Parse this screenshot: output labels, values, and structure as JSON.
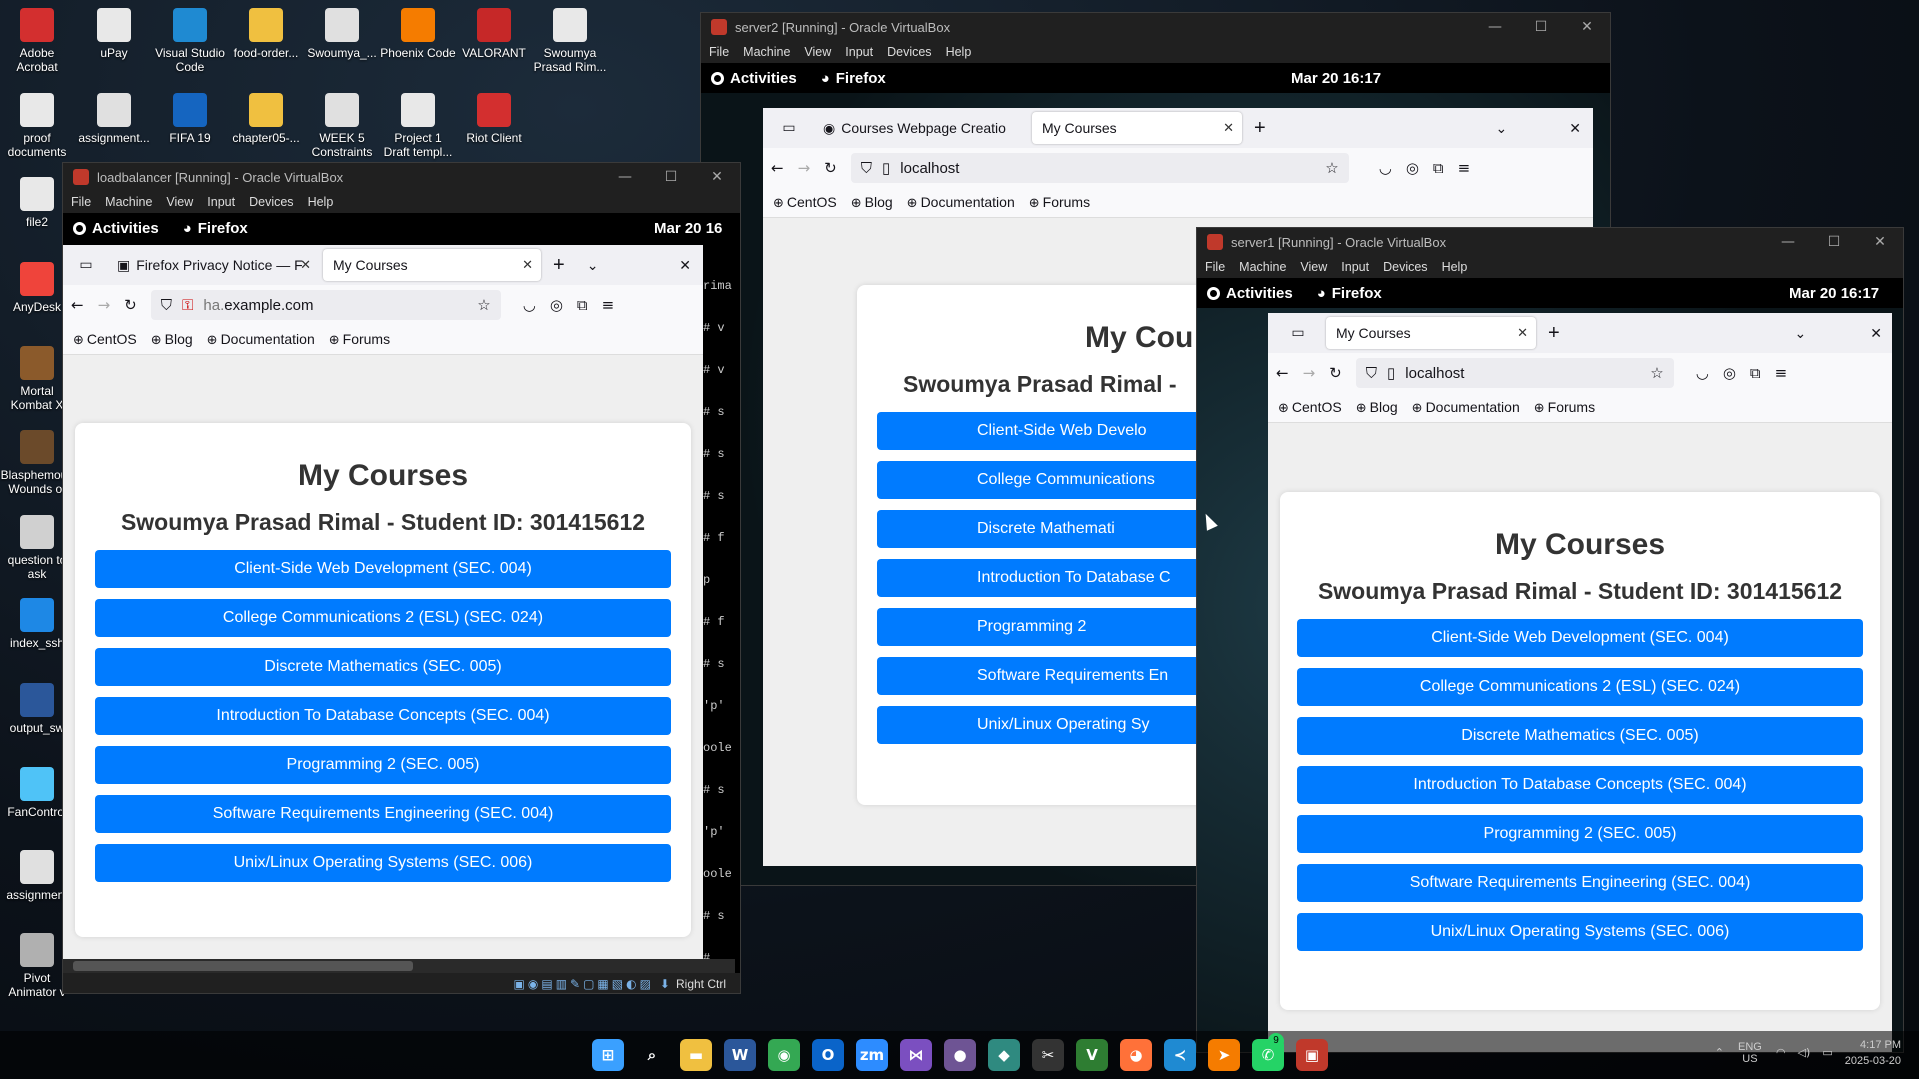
{
  "desktop": {
    "icons_col1": [
      {
        "label": "Adobe Acrobat",
        "icon": "acrobat-icon",
        "color": "#d32f2f"
      },
      {
        "label": "proof documents",
        "icon": "chrome-doc-icon",
        "color": "#e8e8e8"
      },
      {
        "label": "file2",
        "icon": "chrome-doc-icon",
        "color": "#e8e8e8"
      },
      {
        "label": "AnyDesk",
        "icon": "anydesk-icon",
        "color": "#ef443b"
      },
      {
        "label": "Mortal Kombat X",
        "icon": "game-icon",
        "color": "#8b5a2b"
      },
      {
        "label": "Blasphemous Wounds of",
        "icon": "game-icon",
        "color": "#6b4a2a"
      },
      {
        "label": "question to ask",
        "icon": "doc-icon",
        "color": "#d0d0d0"
      },
      {
        "label": "index_ssh",
        "icon": "edge-icon",
        "color": "#1e88e5"
      },
      {
        "label": "output_sw",
        "icon": "word-icon",
        "color": "#2b579a"
      },
      {
        "label": "FanControl",
        "icon": "fan-icon",
        "color": "#4fc3f7"
      },
      {
        "label": "assignment",
        "icon": "doc-icon",
        "color": "#e0e0e0"
      },
      {
        "label": "Pivot Animator v",
        "icon": "pivot-icon",
        "color": "#b0b0b0"
      }
    ],
    "icons_row1": [
      {
        "label": "uPay",
        "icon": "chrome-doc-icon",
        "color": "#e8e8e8"
      },
      {
        "label": "Visual Studio Code",
        "icon": "vscode-icon",
        "color": "#1f8ad2"
      },
      {
        "label": "food-order...",
        "icon": "folder-icon",
        "color": "#f0c040"
      },
      {
        "label": "Swoumya_...",
        "icon": "pdf-icon",
        "color": "#e0e0e0"
      },
      {
        "label": "Phoenix Code",
        "icon": "phoenix-icon",
        "color": "#f57c00"
      },
      {
        "label": "VALORANT",
        "icon": "valorant-icon",
        "color": "#c62828"
      },
      {
        "label": "Swoumya Prasad Rim...",
        "icon": "chrome-doc-icon",
        "color": "#e8e8e8"
      }
    ],
    "icons_row2": [
      {
        "label": "assignment...",
        "icon": "doc-icon",
        "color": "#e0e0e0"
      },
      {
        "label": "FIFA 19",
        "icon": "fifa-icon",
        "color": "#1565c0"
      },
      {
        "label": "chapter05-...",
        "icon": "folder-icon",
        "color": "#f0c040"
      },
      {
        "label": "WEEK 5 Constraints",
        "icon": "pdf-icon",
        "color": "#e0e0e0"
      },
      {
        "label": "Project 1 Draft templ...",
        "icon": "chrome-doc-icon",
        "color": "#e8e8e8"
      },
      {
        "label": "Riot Client",
        "icon": "riot-icon",
        "color": "#d32f2f"
      }
    ]
  },
  "course_page": {
    "title": "My Courses",
    "student": "Swoumya Prasad Rimal - Student ID: 301415612",
    "courses": [
      "Client-Side Web Development (SEC. 004)",
      "College Communications 2 (ESL) (SEC. 024)",
      "Discrete Mathematics (SEC. 005)",
      "Introduction To Database Concepts (SEC. 004)",
      "Programming 2 (SEC. 005)",
      "Software Requirements Engineering (SEC. 004)",
      "Unix/Linux Operating Systems (SEC. 006)"
    ],
    "button_color": "#007bff"
  },
  "vbox_menu": [
    "File",
    "Machine",
    "View",
    "Input",
    "Devices",
    "Help"
  ],
  "gnome": {
    "activities": "Activities",
    "app": "Firefox",
    "clock": "Mar 20  16:17",
    "clock_short": "Mar 20  16"
  },
  "bookmarks": [
    "CentOS",
    "Blog",
    "Documentation",
    "Forums"
  ],
  "server2": {
    "title": "server2 [Running] - Oracle VirtualBox",
    "tab1": "Courses Webpage Creatio",
    "tab2": "My Courses",
    "url": "localhost",
    "partial_courses": [
      "Client-Side Web Develo",
      "College Communications",
      "Discrete Mathemati",
      "Introduction To Database C",
      "Programming 2",
      "Software Requirements En",
      "Unix/Linux Operating Sy"
    ],
    "partial_title": "My Cou",
    "partial_student": "Swoumya Prasad Rimal -"
  },
  "loadbalancer": {
    "title": "loadbalancer [Running] - Oracle VirtualBox",
    "tab1": "Firefox Privacy Notice — F",
    "tab2": "My Courses",
    "url_host": "ha.",
    "url_domain": "example.com",
    "status": "Right Ctrl",
    "terminal_lines": [
      "rima",
      "# v",
      "# v",
      "# s",
      "# s",
      "# s",
      "# f",
      "p",
      "# f",
      "# s",
      "'p'",
      "oole",
      "# s",
      "'p'",
      "oole",
      "# s",
      "#"
    ]
  },
  "server1": {
    "title": "server1 [Running] - Oracle VirtualBox",
    "tab1": "My Courses",
    "url": "localhost"
  },
  "taskbar": {
    "icons": [
      {
        "name": "windows-start-icon",
        "glyph": "⊞",
        "color": "#3aa0ff"
      },
      {
        "name": "search-icon",
        "glyph": "⌕",
        "color": "transparent"
      },
      {
        "name": "file-explorer-icon",
        "glyph": "▬",
        "color": "#f0c040"
      },
      {
        "name": "word-icon",
        "glyph": "W",
        "color": "#2b579a"
      },
      {
        "name": "chrome-icon",
        "glyph": "◉",
        "color": "#34a853"
      },
      {
        "name": "outlook-icon",
        "glyph": "O",
        "color": "#0a64c9"
      },
      {
        "name": "zoom-icon",
        "glyph": "zm",
        "color": "#2d8cff"
      },
      {
        "name": "visual-studio-icon",
        "glyph": "⋈",
        "color": "#7b4fc0"
      },
      {
        "name": "github-icon",
        "glyph": "●",
        "color": "#6e5494"
      },
      {
        "name": "app-icon",
        "glyph": "◆",
        "color": "#2f8a80"
      },
      {
        "name": "capcut-icon",
        "glyph": "✂",
        "color": "#333"
      },
      {
        "name": "vscode-alt-icon",
        "glyph": "V",
        "color": "#2e7d32"
      },
      {
        "name": "firefox-icon",
        "glyph": "◕",
        "color": "#ff7139"
      },
      {
        "name": "vscode-icon",
        "glyph": "≺",
        "color": "#1f8ad2"
      },
      {
        "name": "phoenix-icon",
        "glyph": "➤",
        "color": "#f57c00"
      },
      {
        "name": "whatsapp-icon",
        "glyph": "✆",
        "color": "#25d366"
      },
      {
        "name": "virtualbox-icon",
        "glyph": "▣",
        "color": "#c0392b"
      }
    ],
    "whatsapp_badge": "9",
    "lang": "ENG US",
    "time": "4:17 PM",
    "date": "2025-03-20"
  }
}
